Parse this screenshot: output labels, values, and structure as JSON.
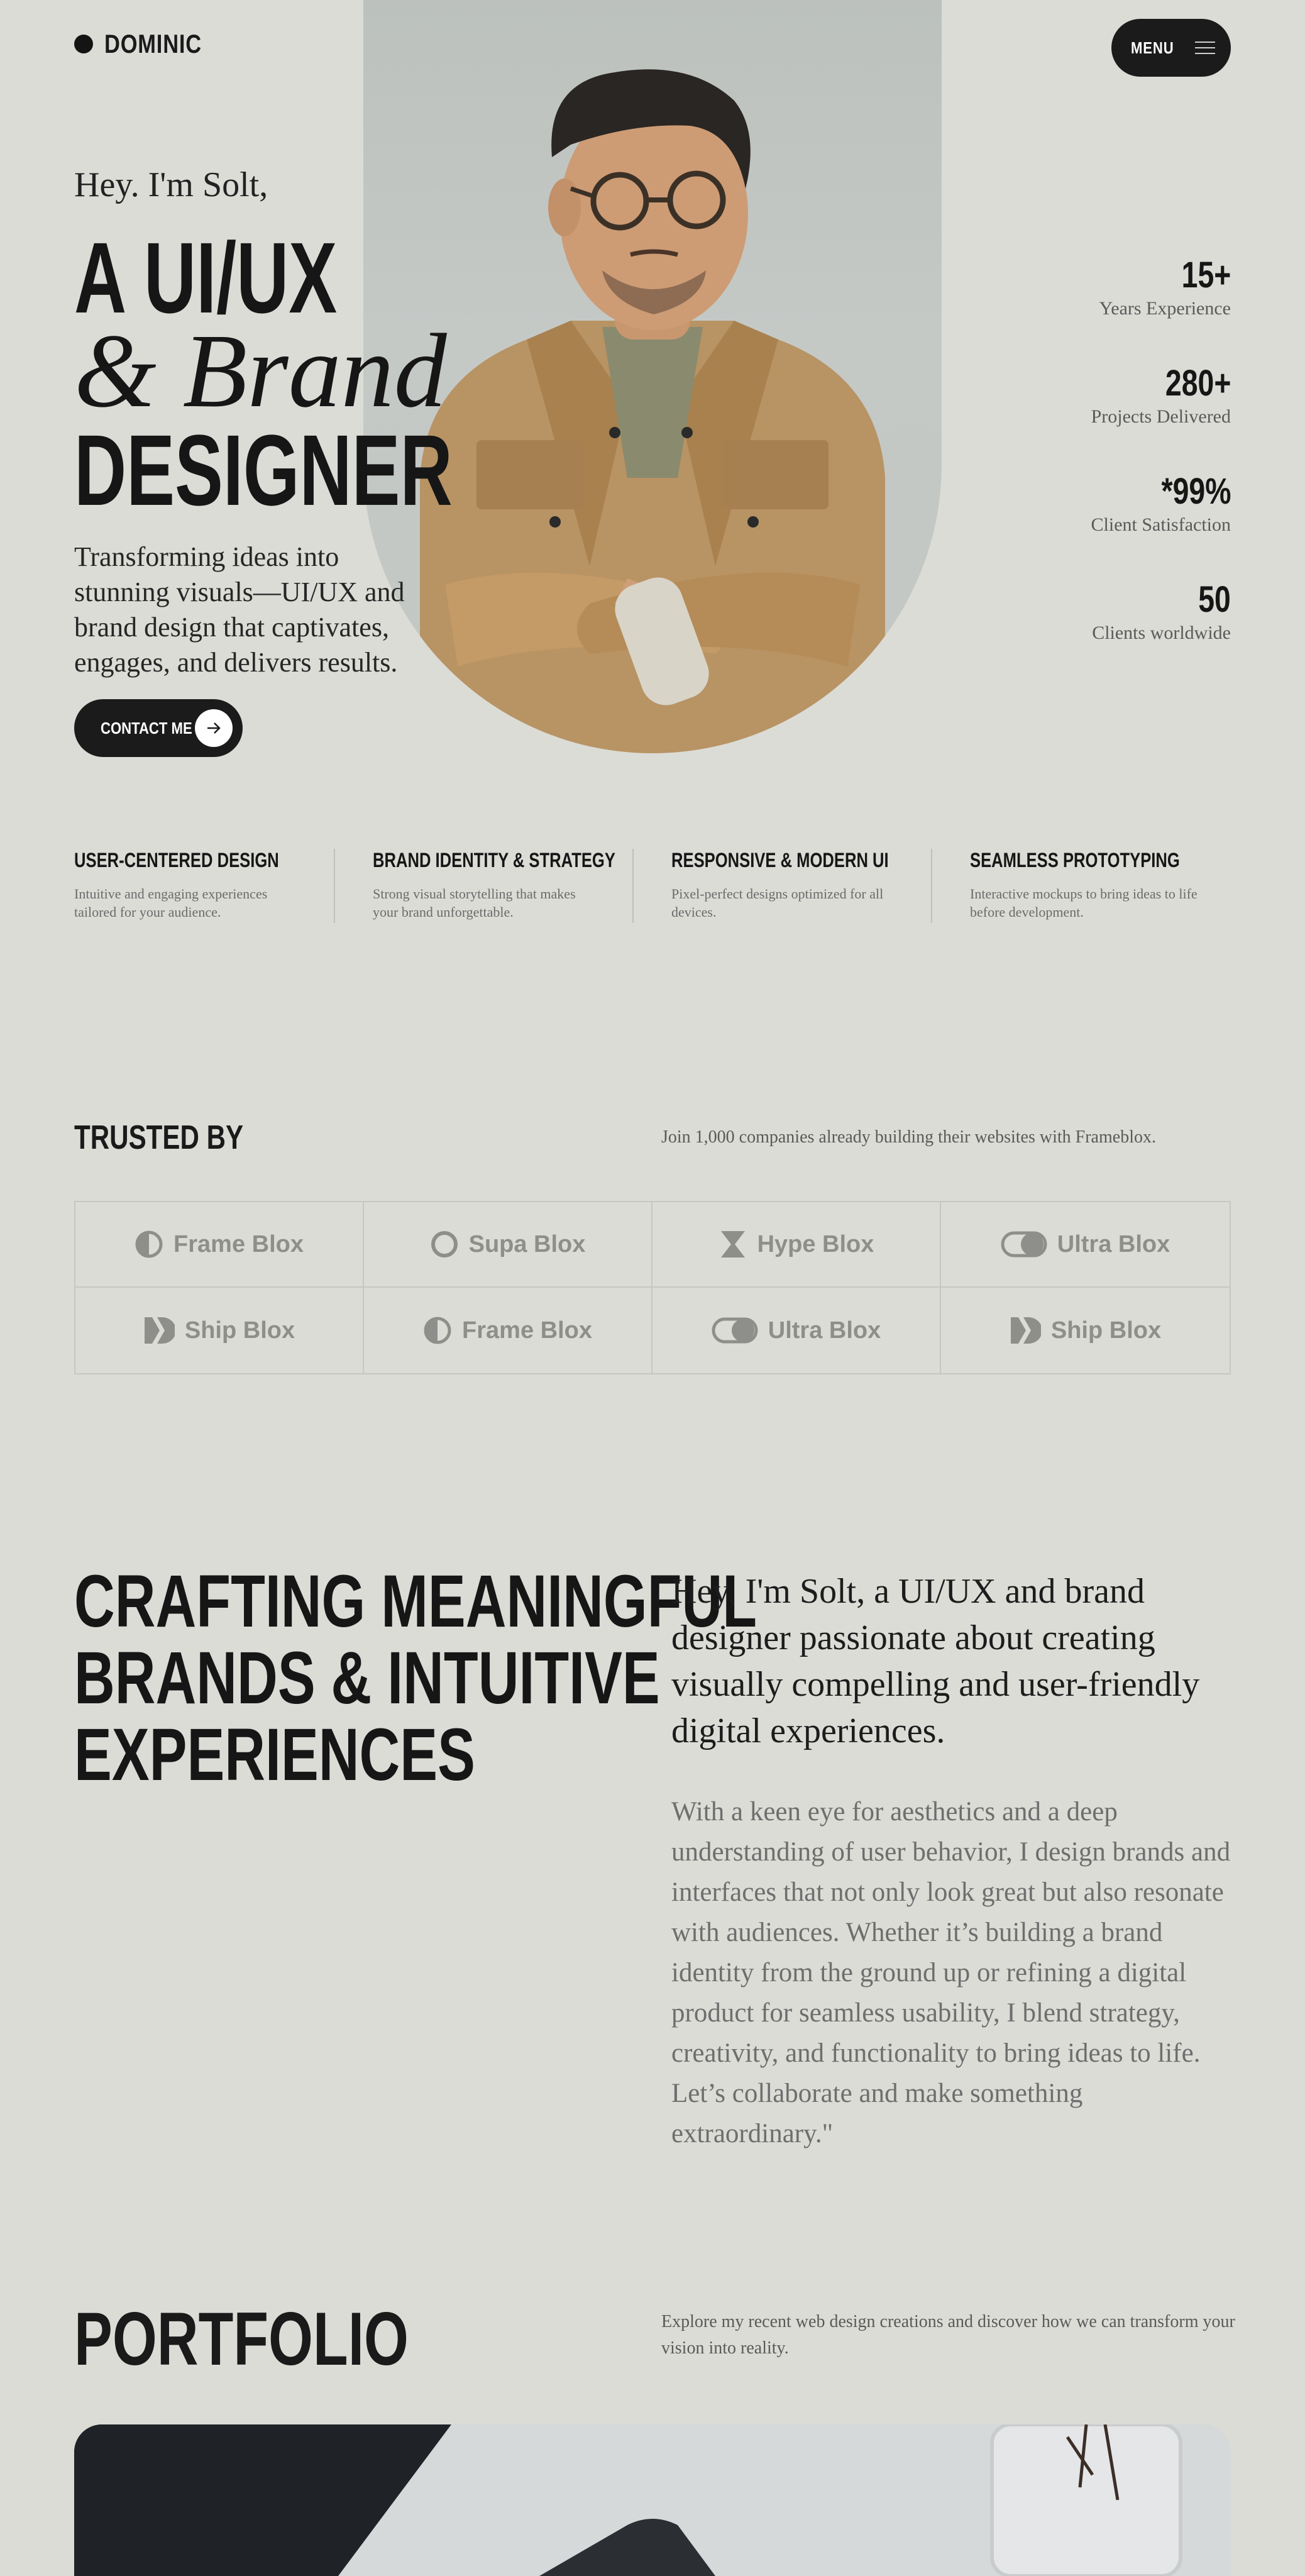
{
  "header": {
    "logo_text": "DOMINIC",
    "menu_label": "MENU"
  },
  "hero": {
    "greeting": "Hey. I'm Solt,",
    "headline_line1": "A UI/UX",
    "headline_line2": "& Brand",
    "headline_line3": "DESIGNER",
    "description": "Transforming ideas into stunning visuals—UI/UX and brand design that captivates, engages, and delivers results.",
    "cta_label": "CONTACT ME",
    "stats": [
      {
        "value": "15+",
        "label": "Years Experience"
      },
      {
        "value": "280+",
        "label": "Projects Delivered"
      },
      {
        "value": "*99%",
        "label": "Client Satisfaction"
      },
      {
        "value": "50",
        "label": "Clients worldwide"
      }
    ]
  },
  "services": [
    {
      "title": "USER-CENTERED DESIGN",
      "desc": "Intuitive and engaging experiences tailored for your audience."
    },
    {
      "title": "BRAND IDENTITY & STRATEGY",
      "desc": "Strong visual storytelling that makes your brand unforgettable."
    },
    {
      "title": "RESPONSIVE & MODERN UI",
      "desc": "Pixel-perfect designs optimized for all devices."
    },
    {
      "title": "SEAMLESS PROTOTYPING",
      "desc": "Interactive mockups to bring ideas to life before development."
    }
  ],
  "trusted": {
    "title": "TRUSTED BY",
    "subtitle": "Join 1,000 companies already building their websites with Frameblox.",
    "logos": [
      {
        "name": "Frame Blox",
        "icon": "half-circle-icon"
      },
      {
        "name": "Supa Blox",
        "icon": "ring-icon"
      },
      {
        "name": "Hype Blox",
        "icon": "hourglass-icon"
      },
      {
        "name": "Ultra Blox",
        "icon": "toggle-icon"
      },
      {
        "name": "Ship Blox",
        "icon": "double-chevron-icon"
      },
      {
        "name": "Frame Blox",
        "icon": "half-circle-icon"
      },
      {
        "name": "Ultra Blox",
        "icon": "toggle-icon"
      },
      {
        "name": "Ship Blox",
        "icon": "double-chevron-icon"
      }
    ]
  },
  "about": {
    "heading_line1": "CRAFTING MEANINGFUL",
    "heading_line2": "BRANDS & INTUITIVE",
    "heading_line3": "EXPERIENCES",
    "lead": "Hey, I'm Solt, a UI/UX and brand designer passionate about creating visually compelling and user-friendly digital experiences.",
    "body": "With a keen eye for aesthetics and a deep understanding of user behavior, I design brands and interfaces that not only look great but also resonate with audiences. Whether it’s building a brand identity from the ground up or refining a digital product for seamless usability, I blend strategy, creativity, and functionality to bring ideas to life. Let’s collaborate and make something extraordinary.\""
  },
  "portfolio": {
    "title": "PORTFOLIO",
    "subtitle": "Explore my recent web design creations and discover how we can transform your vision into reality."
  },
  "colors": {
    "background": "#dbdcd6",
    "ink": "#1b1b1b",
    "muted": "#6e6e6e",
    "logo_gray": "#8e8f8b"
  }
}
